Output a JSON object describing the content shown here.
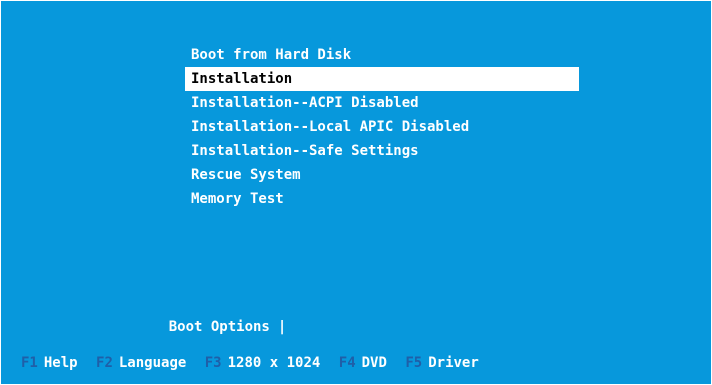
{
  "menu": {
    "items": [
      {
        "label": "Boot from Hard Disk"
      },
      {
        "label": "Installation"
      },
      {
        "label": "Installation--ACPI Disabled"
      },
      {
        "label": "Installation--Local APIC Disabled"
      },
      {
        "label": "Installation--Safe Settings"
      },
      {
        "label": "Rescue System"
      },
      {
        "label": "Memory Test"
      }
    ],
    "selected_index": 1
  },
  "boot_options": {
    "label": "Boot Options",
    "value": "",
    "cursor": "|"
  },
  "function_keys": [
    {
      "key": "F1",
      "label": "Help"
    },
    {
      "key": "F2",
      "label": "Language"
    },
    {
      "key": "F3",
      "label": "1280 x 1024"
    },
    {
      "key": "F4",
      "label": "DVD"
    },
    {
      "key": "F5",
      "label": "Driver"
    }
  ],
  "colors": {
    "background": "#0798dc",
    "text": "#ffffff",
    "selection_background": "#ffffff",
    "selection_text": "#000000",
    "function_key": "#1f5fa8"
  }
}
